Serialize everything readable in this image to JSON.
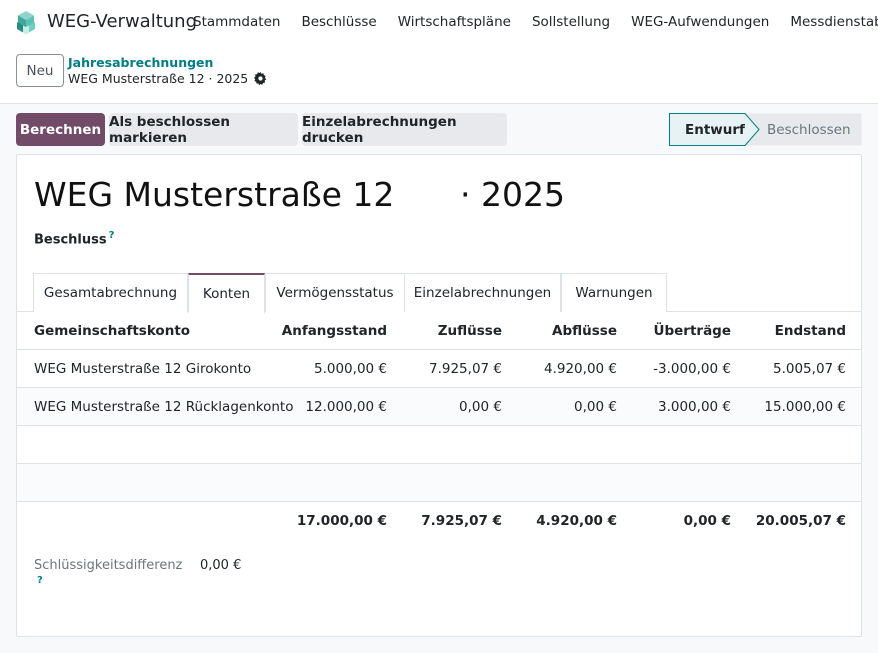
{
  "app": {
    "name": "WEG-Verwaltung",
    "logo_icon": "cube-logo-icon",
    "accent": "#714b67",
    "link_color": "#017e84"
  },
  "nav": {
    "items": [
      "Stammdaten",
      "Beschlüsse",
      "Wirtschaftspläne",
      "Sollstellung",
      "WEG-Aufwendungen",
      "Messdienstabrechnu"
    ]
  },
  "control_panel": {
    "new_label": "Neu",
    "breadcrumb_parent": "Jahresabrechnungen",
    "breadcrumb_current": "WEG Musterstraße 12 · 2025",
    "settings_icon": "gear-icon"
  },
  "actions": {
    "compute_label": "Berechnen",
    "mark_resolved_label": "Als beschlossen markieren",
    "print_label": "Einzelabrechnungen drucken"
  },
  "status": {
    "active": "Entwurf",
    "next": "Beschlossen"
  },
  "form": {
    "title": "WEG Musterstraße 12",
    "year": "· 2025",
    "beschluss_label": "Beschluss",
    "help_mark": "?"
  },
  "tabs": [
    "Gesamtabrechnung",
    "Konten",
    "Vermögensstatus",
    "Einzelabrechnungen",
    "Warnungen"
  ],
  "active_tab": "Konten",
  "table": {
    "columns": [
      "Gemeinschaftskonto",
      "Anfangsstand",
      "Zuflüsse",
      "Abflüsse",
      "Überträge",
      "Endstand"
    ],
    "rows": [
      [
        "WEG Musterstraße 12 Girokonto",
        "5.000,00 €",
        "7.925,07 €",
        "4.920,00 €",
        "-3.000,00 €",
        "5.005,07 €"
      ],
      [
        "WEG Musterstraße 12 Rücklagenkonto",
        "12.000,00 €",
        "0,00 €",
        "0,00 €",
        "3.000,00 €",
        "15.000,00 €"
      ]
    ],
    "totals": [
      "",
      "17.000,00 €",
      "7.925,07 €",
      "4.920,00 €",
      "0,00 €",
      "20.005,07 €"
    ]
  },
  "difference": {
    "label": "Schlüssigkeitsdifferenz",
    "value": "0,00 €",
    "help_mark": "?"
  }
}
